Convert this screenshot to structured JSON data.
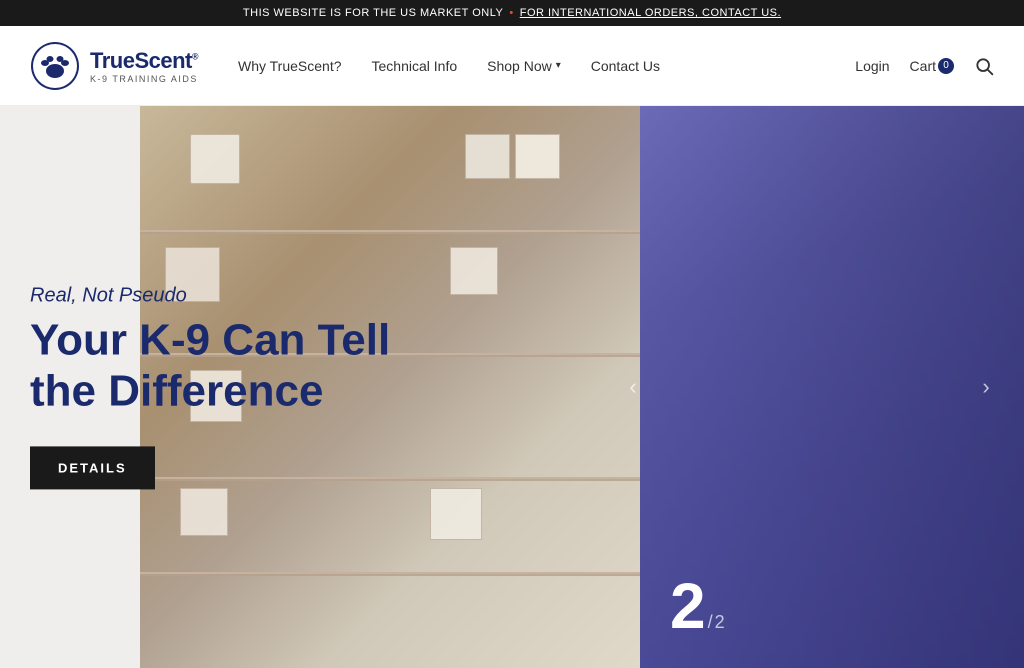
{
  "banner": {
    "text_main": "THIS WEBSITE IS FOR THE US MARKET ONLY",
    "dot": "•",
    "text_link": "FOR INTERNATIONAL ORDERS, CONTACT US.",
    "separator": " "
  },
  "header": {
    "logo_brand": "TrueScent",
    "logo_trademark": "®",
    "logo_sub": "K-9 TRAINING AIDS",
    "nav_items": [
      {
        "label": "Why TrueScent?",
        "dropdown": false
      },
      {
        "label": "Technical Info",
        "dropdown": false
      },
      {
        "label": "Shop Now",
        "dropdown": true
      },
      {
        "label": "Contact Us",
        "dropdown": false
      }
    ],
    "login_label": "Login",
    "cart_label": "Cart",
    "cart_count": "0",
    "search_icon": "search-icon"
  },
  "hero": {
    "subtitle": "Real, Not Pseudo",
    "title_line1": "Your K-9 Can Tell",
    "title_line2": "the Difference",
    "cta_label": "DETAILS",
    "slide_current": "2",
    "slide_separator": "/",
    "slide_total": "2",
    "prev_arrow": "‹",
    "next_arrow": "›"
  }
}
